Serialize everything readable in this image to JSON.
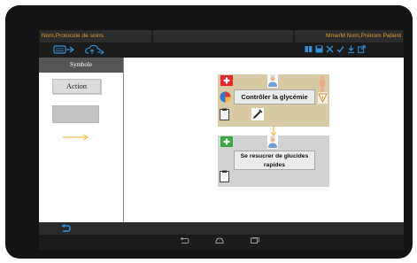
{
  "header": {
    "left_title": "Nom,Protocole de soins",
    "right_title": "Mme/M Nom,Prénom Patient"
  },
  "sidebar": {
    "title": "Symbole",
    "action_label": "Action"
  },
  "nodes": [
    {
      "label": "Contrôler la glycémie"
    },
    {
      "label_line1": "Se resucrer de glucides",
      "label_line2": "rapides"
    }
  ],
  "colors": {
    "accent_orange": "#e09a2a",
    "toolbar_blue": "#2f90d8",
    "node1_bg": "#d9caa6",
    "node2_bg": "#d2d2d2",
    "cross_red": "#e3262c",
    "cross_green": "#3aaa3a"
  },
  "icons": {
    "toolbar_left": [
      "keyboard-send-icon",
      "cloud-upload-icon"
    ],
    "toolbar_right": [
      "book-icon",
      "save-icon",
      "close-icon",
      "check-icon",
      "download-icon",
      "share-icon"
    ],
    "nav": [
      "back-icon",
      "home-icon",
      "recent-apps-icon"
    ]
  }
}
